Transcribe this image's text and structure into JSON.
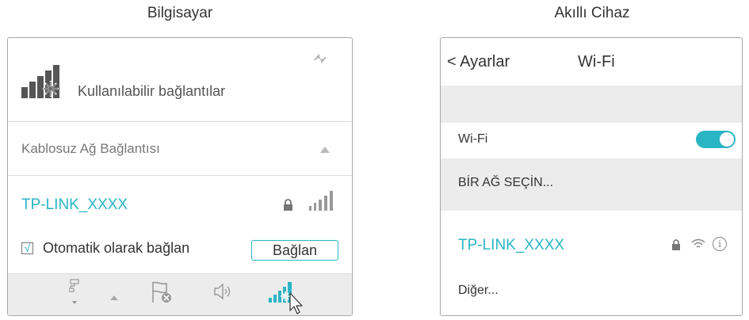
{
  "computer": {
    "heading": "Bilgisayar",
    "available_label": "Kullanılabilir bağlantılar",
    "section_label": "Kablosuz Ağ Bağlantısı",
    "network_name": "TP-LINK_XXXX",
    "auto_connect_label": "Otomatik olarak bağlan",
    "auto_connect_checked": true,
    "connect_button": "Bağlan",
    "icons": [
      "signal-bars-icon",
      "refresh-icon",
      "lock-icon",
      "network-icon",
      "flag-icon",
      "speaker-icon",
      "wifi-tray-icon",
      "mouse-cursor-icon"
    ]
  },
  "device": {
    "heading": "Akıllı Cihaz",
    "back_label": "< Ayarlar",
    "title": "Wi-Fi",
    "wifi_label": "Wi-Fi",
    "wifi_on": true,
    "choose_network_label": "BİR AĞ SEÇİN...",
    "network_name": "TP-LINK_XXXX",
    "other_label": "Diğer...",
    "accent_color": "#2ab5c4"
  }
}
